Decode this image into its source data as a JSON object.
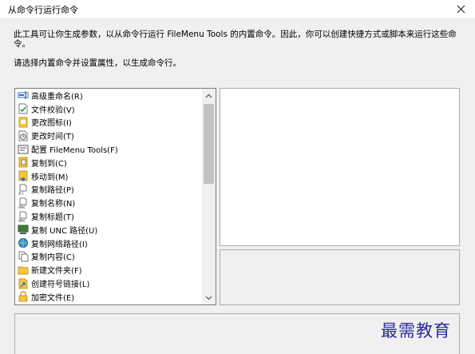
{
  "window": {
    "title": "从命令行运行命令",
    "close_glyph": "✕"
  },
  "description": "此工具可让你生成参数，以从命令行运行 FileMenu Tools 的内置命令。因此，你可以创建快捷方式或脚本来运行这些命令。",
  "instruction": "请选择内置命令并设置属性，以生成命令行。",
  "commands": [
    {
      "label": "高级重命名(R)",
      "icon": "rename-icon"
    },
    {
      "label": "文件校验(V)",
      "icon": "file-check-icon"
    },
    {
      "label": "更改图标(I)",
      "icon": "change-icon-icon"
    },
    {
      "label": "更改时间(T)",
      "icon": "clock-icon"
    },
    {
      "label": "配置 FileMenu Tools(F)",
      "icon": "configure-icon"
    },
    {
      "label": "复制到(C)",
      "icon": "copy-to-icon"
    },
    {
      "label": "移动到(M)",
      "icon": "move-to-icon"
    },
    {
      "label": "复制路径(P)",
      "icon": "copy-path-icon"
    },
    {
      "label": "复制名称(N)",
      "icon": "copy-name-icon"
    },
    {
      "label": "复制标题(T)",
      "icon": "copy-title-icon"
    },
    {
      "label": "复制 UNC 路径(U)",
      "icon": "unc-path-icon"
    },
    {
      "label": "复制网络路径(I)",
      "icon": "network-path-icon"
    },
    {
      "label": "复制内容(C)",
      "icon": "copy-content-icon"
    },
    {
      "label": "新建文件夹(F)",
      "icon": "new-folder-icon"
    },
    {
      "label": "创建符号链接(L)",
      "icon": "symlink-icon"
    },
    {
      "label": "加密文件(E)",
      "icon": "encrypt-icon"
    }
  ],
  "watermark": "最需教育",
  "colors": {
    "background": "#f0f0f0",
    "folder_yellow": "#f5c542",
    "accent_blue": "#2b6cd4",
    "watermark": "#2a2a9a"
  }
}
